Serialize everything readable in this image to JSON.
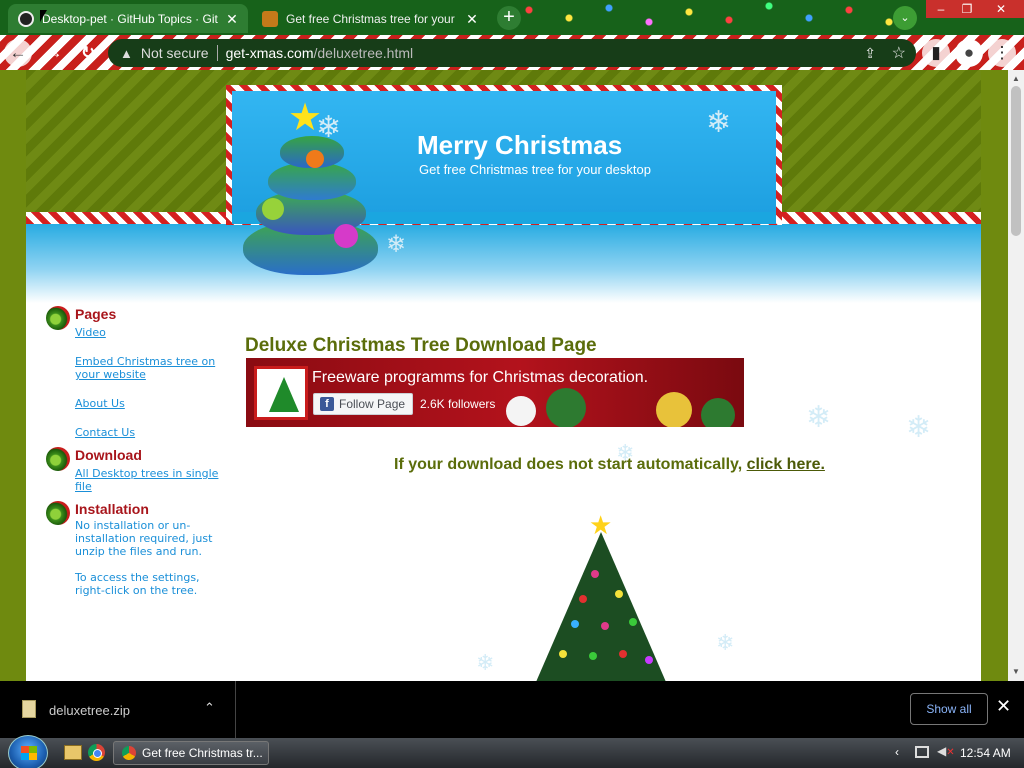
{
  "browser": {
    "tabs": [
      {
        "title": "Desktop-pet · GitHub Topics · Git",
        "close": "✕"
      },
      {
        "title": "Get free Christmas tree for your",
        "close": "✕"
      }
    ],
    "new_tab": "+",
    "tab_search": "⌄",
    "window_buttons": {
      "minimize": "–",
      "maximize": "❐",
      "close": "✕"
    },
    "security_label": "Not secure",
    "url_host": "get-xmas.com",
    "url_path": "/deluxetree.html"
  },
  "site": {
    "title": "Merry Christmas",
    "subtitle": "Get free Christmas tree for your desktop"
  },
  "sidebar": {
    "pages_heading": "Pages",
    "pages_links": [
      "Video",
      "Embed Christmas tree on your website",
      "About Us",
      "Contact Us"
    ],
    "download_heading": "Download",
    "download_link": "All Desktop trees in single file",
    "install_heading": "Installation",
    "install_text_1": "No installation or un-installation required, just unzip the files and run.",
    "install_text_2": "To access the settings, right-click on the tree."
  },
  "main": {
    "heading": "Deluxe Christmas Tree Download Page",
    "fb_title": "Freeware programms for Christmas decoration.",
    "fb_follow": "Follow Page",
    "fb_followers": "2.6K followers",
    "download_msg": "If your download does not start automatically,",
    "download_link": "click here."
  },
  "download_shelf": {
    "file_name": "deluxetree.zip",
    "show_all": "Show all",
    "close": "✕"
  },
  "taskbar": {
    "active_task": "Get free Christmas tr...",
    "time": "12:54 AM"
  },
  "colors": {
    "page_background": "#6f8a0f",
    "heading_green": "#5b6d0b",
    "sidebar_heading_red": "#a8151b",
    "link_blue": "#1a8fd8"
  }
}
